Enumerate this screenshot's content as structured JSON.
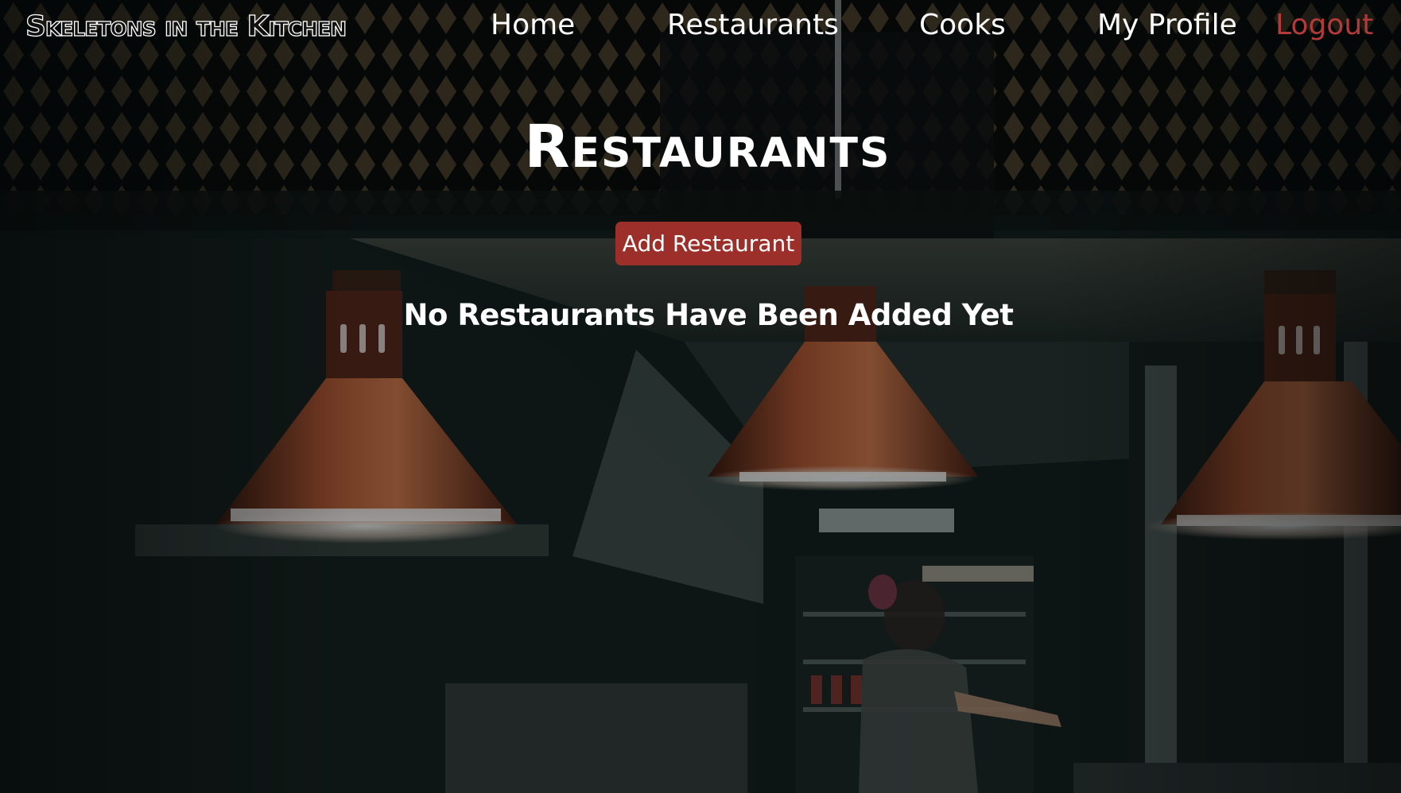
{
  "navbar": {
    "brand": "Skeletons in the Kitchen",
    "links": [
      {
        "label": "Home"
      },
      {
        "label": "Restaurants"
      },
      {
        "label": "Cooks"
      },
      {
        "label": "My Profile"
      },
      {
        "label": "Logout"
      }
    ]
  },
  "main": {
    "title": "Restaurants",
    "add_button_label": "Add Restaurant",
    "empty_message": "No Restaurants Have Been Added Yet"
  },
  "colors": {
    "accent": "#9d2f2b",
    "logout": "#b23a38",
    "text": "#ffffff",
    "background": "#0e1614"
  }
}
